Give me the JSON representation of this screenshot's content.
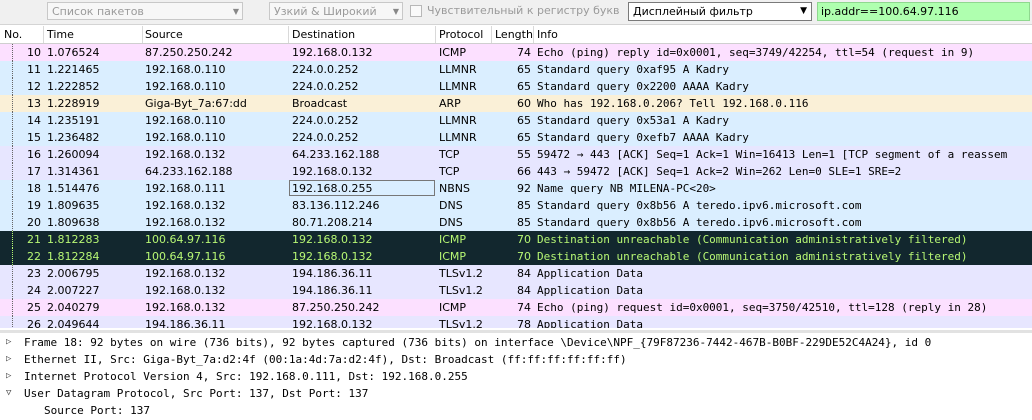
{
  "toolbar": {
    "packet_list_combo": "Список пакетов",
    "width_combo": "Узкий & Широкий",
    "case_sensitive_label": "Чувствительный к регистру букв",
    "filter_type": "Дисплейный фильтр",
    "filter_value": "ip.addr==100.64.97.116"
  },
  "columns": [
    "No.",
    "Time",
    "Source",
    "Destination",
    "Protocol",
    "Length",
    "Info"
  ],
  "colors": {
    "icmp": "#fce0ff",
    "udp": "#daeeff",
    "arp": "#faf0d7",
    "tcp": "#e7e6ff",
    "selected_dark": "#12272e",
    "selected_text": "#b7f774"
  },
  "packets": [
    {
      "no": "10",
      "time": "1.076524",
      "src": "87.250.250.242",
      "dst": "192.168.0.132",
      "proto": "ICMP",
      "len": "74",
      "info": "Echo (ping) reply    id=0x0001, seq=3749/42254, ttl=54 (request in 9)",
      "style": "icmp"
    },
    {
      "no": "11",
      "time": "1.221465",
      "src": "192.168.0.110",
      "dst": "224.0.0.252",
      "proto": "LLMNR",
      "len": "65",
      "info": "Standard query 0xaf95 A Kadry",
      "style": "udp"
    },
    {
      "no": "12",
      "time": "1.222852",
      "src": "192.168.0.110",
      "dst": "224.0.0.252",
      "proto": "LLMNR",
      "len": "65",
      "info": "Standard query 0x2200 AAAA Kadry",
      "style": "udp"
    },
    {
      "no": "13",
      "time": "1.228919",
      "src": "Giga-Byt_7a:67:dd",
      "dst": "Broadcast",
      "proto": "ARP",
      "len": "60",
      "info": "Who has 192.168.0.206? Tell 192.168.0.116",
      "style": "arp"
    },
    {
      "no": "14",
      "time": "1.235191",
      "src": "192.168.0.110",
      "dst": "224.0.0.252",
      "proto": "LLMNR",
      "len": "65",
      "info": "Standard query 0x53a1 A Kadry",
      "style": "udp"
    },
    {
      "no": "15",
      "time": "1.236482",
      "src": "192.168.0.110",
      "dst": "224.0.0.252",
      "proto": "LLMNR",
      "len": "65",
      "info": "Standard query 0xefb7 AAAA Kadry",
      "style": "udp"
    },
    {
      "no": "16",
      "time": "1.260094",
      "src": "192.168.0.132",
      "dst": "64.233.162.188",
      "proto": "TCP",
      "len": "55",
      "info": "59472 → 443 [ACK] Seq=1 Ack=1 Win=16413 Len=1 [TCP segment of a reassem",
      "style": "tcp"
    },
    {
      "no": "17",
      "time": "1.314361",
      "src": "64.233.162.188",
      "dst": "192.168.0.132",
      "proto": "TCP",
      "len": "66",
      "info": "443 → 59472 [ACK] Seq=1 Ack=2 Win=262 Len=0 SLE=1 SRE=2",
      "style": "tcp"
    },
    {
      "no": "18",
      "time": "1.514476",
      "src": "192.168.0.111",
      "dst": "192.168.0.255",
      "proto": "NBNS",
      "len": "92",
      "info": "Name query NB MILENA-PC<20>",
      "style": "selected"
    },
    {
      "no": "19",
      "time": "1.809635",
      "src": "192.168.0.132",
      "dst": "83.136.112.246",
      "proto": "DNS",
      "len": "85",
      "info": "Standard query 0x8b56 A teredo.ipv6.microsoft.com",
      "style": "udp"
    },
    {
      "no": "20",
      "time": "1.809638",
      "src": "192.168.0.132",
      "dst": "80.71.208.214",
      "proto": "DNS",
      "len": "85",
      "info": "Standard query 0x8b56 A teredo.ipv6.microsoft.com",
      "style": "udp"
    },
    {
      "no": "21",
      "time": "1.812283",
      "src": "100.64.97.116",
      "dst": "192.168.0.132",
      "proto": "ICMP",
      "len": "70",
      "info": "Destination unreachable (Communication administratively filtered)",
      "style": "dark"
    },
    {
      "no": "22",
      "time": "1.812284",
      "src": "100.64.97.116",
      "dst": "192.168.0.132",
      "proto": "ICMP",
      "len": "70",
      "info": "Destination unreachable (Communication administratively filtered)",
      "style": "dark"
    },
    {
      "no": "23",
      "time": "2.006795",
      "src": "192.168.0.132",
      "dst": "194.186.36.11",
      "proto": "TLSv1.2",
      "len": "84",
      "info": "Application Data",
      "style": "tcp"
    },
    {
      "no": "24",
      "time": "2.007227",
      "src": "192.168.0.132",
      "dst": "194.186.36.11",
      "proto": "TLSv1.2",
      "len": "84",
      "info": "Application Data",
      "style": "tcp"
    },
    {
      "no": "25",
      "time": "2.040279",
      "src": "192.168.0.132",
      "dst": "87.250.250.242",
      "proto": "ICMP",
      "len": "74",
      "info": "Echo (ping) request  id=0x0001, seq=3750/42510, ttl=128 (reply in 28)",
      "style": "icmp"
    },
    {
      "no": "26",
      "time": "2.049644",
      "src": "194.186.36.11",
      "dst": "192.168.0.132",
      "proto": "TLSv1.2",
      "len": "78",
      "info": "Application Data",
      "style": "tcp"
    }
  ],
  "details": [
    {
      "text": "Frame 18: 92 bytes on wire (736 bits), 92 bytes captured (736 bits) on interface \\Device\\NPF_{79F87236-7442-467B-B0BF-229DE52C4A24}, id 0",
      "expandable": true
    },
    {
      "text": "Ethernet II, Src: Giga-Byt_7a:d2:4f (00:1a:4d:7a:d2:4f), Dst: Broadcast (ff:ff:ff:ff:ff:ff)",
      "expandable": true
    },
    {
      "text": "Internet Protocol Version 4, Src: 192.168.0.111, Dst: 192.168.0.255",
      "expandable": true
    },
    {
      "text": "User Datagram Protocol, Src Port: 137, Dst Port: 137",
      "expandable": true,
      "expanded": true
    },
    {
      "text": "Source Port: 137",
      "expandable": false,
      "sub": true
    }
  ]
}
